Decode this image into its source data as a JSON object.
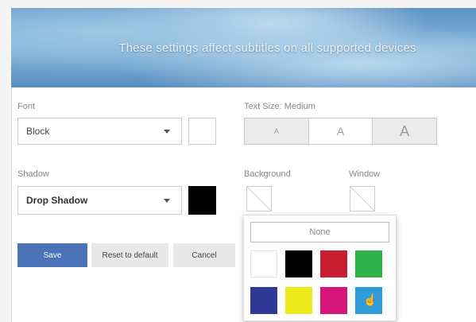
{
  "banner": {
    "text": "These settings affect subtitles on all supported devices"
  },
  "font": {
    "label": "Font",
    "value": "Block",
    "color": "#ffffff"
  },
  "text_size": {
    "label": "Text Size: Medium",
    "options": [
      "A",
      "A",
      "A"
    ],
    "selected_index": 1
  },
  "shadow": {
    "label": "Shadow",
    "value": "Drop Shadow",
    "color": "#000000"
  },
  "background": {
    "label": "Background"
  },
  "window": {
    "label": "Window"
  },
  "buttons": {
    "save": "Save",
    "reset": "Reset to default",
    "cancel": "Cancel"
  },
  "color_popup": {
    "none_label": "None",
    "colors": [
      {
        "name": "white",
        "hex": "#ffffff"
      },
      {
        "name": "black",
        "hex": "#000000"
      },
      {
        "name": "red",
        "hex": "#c81e32"
      },
      {
        "name": "green",
        "hex": "#2eb04a"
      },
      {
        "name": "blue",
        "hex": "#2e3a96"
      },
      {
        "name": "yellow",
        "hex": "#ecea1c"
      },
      {
        "name": "magenta",
        "hex": "#d6157a"
      },
      {
        "name": "cyan",
        "hex": "#2f9cd9"
      }
    ],
    "hovered_index": 7
  }
}
